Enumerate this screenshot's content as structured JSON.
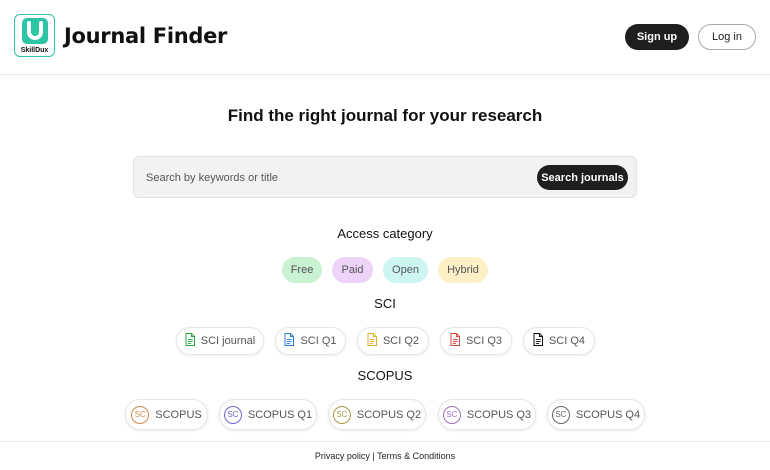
{
  "header": {
    "logo_text": "SkillDux",
    "title": "Journal Finder",
    "signup_label": "Sign up",
    "login_label": "Log in"
  },
  "main": {
    "headline": "Find the right journal for your research",
    "search": {
      "placeholder": "Search by keywords or title",
      "button_label": "Search journals"
    }
  },
  "access": {
    "title": "Access category",
    "chips": [
      {
        "label": "Free",
        "color": "#c9f2d3"
      },
      {
        "label": "Paid",
        "color": "#ecd3f7"
      },
      {
        "label": "Open",
        "color": "#cdf6f3"
      },
      {
        "label": "Hybrid",
        "color": "#fdf0c6"
      }
    ]
  },
  "sci": {
    "title": "SCI",
    "items": [
      {
        "label": "SCI journal",
        "icon": "document-icon",
        "color": "#2aa845"
      },
      {
        "label": "SCI Q1",
        "icon": "document-icon",
        "color": "#2b7fd1"
      },
      {
        "label": "SCI Q2",
        "icon": "document-icon",
        "color": "#e0b22a"
      },
      {
        "label": "SCI Q3",
        "icon": "document-icon",
        "color": "#d9453a"
      },
      {
        "label": "SCI Q4",
        "icon": "document-icon",
        "color": "#111111"
      }
    ]
  },
  "scopus": {
    "title": "SCOPUS",
    "items": [
      {
        "badge": "SC",
        "label": "SCOPUS",
        "color": "#d08a4a"
      },
      {
        "badge": "SC",
        "label": "SCOPUS Q1",
        "color": "#6a6ad0"
      },
      {
        "badge": "SC",
        "label": "SCOPUS Q2",
        "color": "#a89a4a"
      },
      {
        "badge": "SC",
        "label": "SCOPUS Q3",
        "color": "#a070c8"
      },
      {
        "badge": "SC",
        "label": "SCOPUS Q4",
        "color": "#666666"
      }
    ]
  },
  "footer": {
    "privacy_label": "Privacy policy",
    "separator": "|",
    "terms_label": "Terms & Conditions"
  },
  "colors": {
    "brand": "#2ec4a6",
    "primary_button": "#1e1e1e"
  }
}
